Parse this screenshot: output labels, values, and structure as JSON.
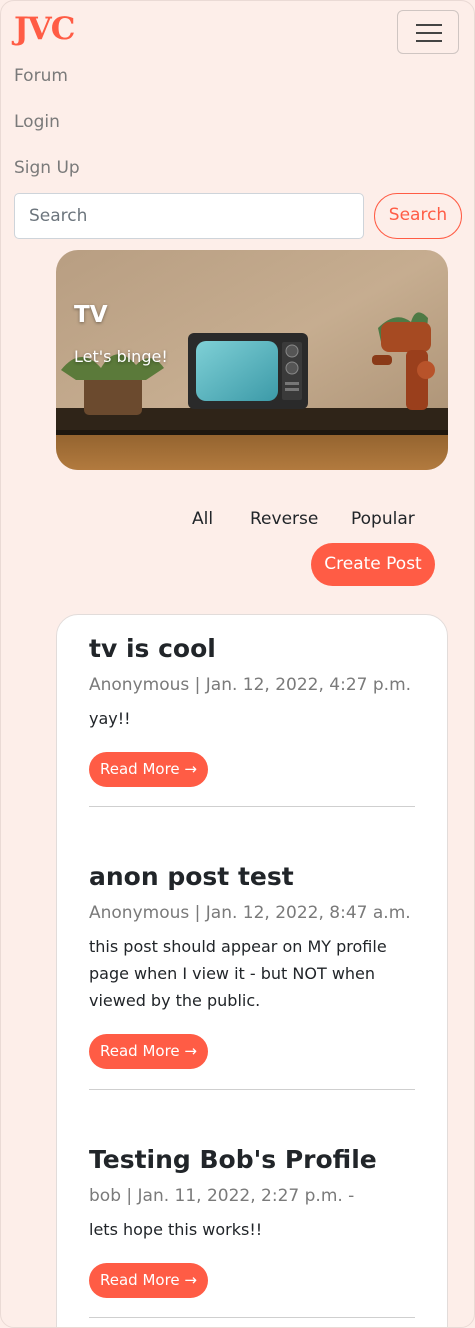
{
  "navbar": {
    "brand": "JVC",
    "toggle_icon": "hamburger-menu-icon",
    "links": [
      "Forum",
      "Login",
      "Sign Up"
    ]
  },
  "search": {
    "placeholder": "Search",
    "button_label": "Search"
  },
  "hero": {
    "title": "TV",
    "subtitle": "Let's binge!"
  },
  "filters": [
    "All",
    "Reverse",
    "Popular"
  ],
  "create_post_label": "Create Post",
  "posts": [
    {
      "title": "tv is cool",
      "meta": "Anonymous | Jan. 12, 2022, 4:27 p.m.",
      "body": "yay!!",
      "read_more": "Read More →"
    },
    {
      "title": "anon post test",
      "meta": "Anonymous | Jan. 12, 2022, 8:47 a.m.",
      "body": "this post should appear on MY profile page when I view it - but NOT when viewed by the public.",
      "read_more": "Read More →"
    },
    {
      "title": "Testing Bob's Profile",
      "meta": "bob | Jan. 11, 2022, 2:27 p.m. -",
      "body": "lets hope this works!!",
      "read_more": "Read More →"
    }
  ],
  "colors": {
    "accent": "#ff5c45",
    "page_background": "#fdeee9",
    "card_background": "#ffffff",
    "muted_text": "#7a7a7a"
  }
}
